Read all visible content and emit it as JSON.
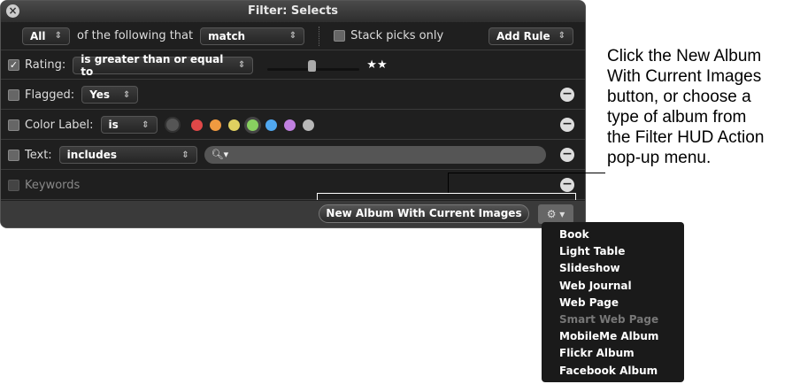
{
  "window": {
    "title": "Filter: Selects"
  },
  "match_row": {
    "scope": "All",
    "text": "of the following that",
    "mode": "match",
    "stack_picks_label": "Stack picks only",
    "stack_picks_checked": false,
    "add_rule": "Add Rule"
  },
  "rules": {
    "rating": {
      "label": "Rating:",
      "checked": true,
      "operator": "is greater than or equal to",
      "value_stars": "★★",
      "slider_value": 2
    },
    "flagged": {
      "label": "Flagged:",
      "checked": false,
      "value": "Yes"
    },
    "color_label": {
      "label": "Color Label:",
      "checked": false,
      "operator": "is",
      "selected": "green"
    },
    "text": {
      "label": "Text:",
      "checked": false,
      "operator": "includes",
      "search_value": ""
    },
    "keywords": {
      "label": "Keywords",
      "checked": false
    }
  },
  "colors": {
    "none": "#555555",
    "red": "#e04848",
    "orange": "#f09a40",
    "yellow": "#e0d060",
    "green": "#88d060",
    "blue": "#50a8f0",
    "purple": "#c080e0",
    "gray": "#b8b8b8"
  },
  "bottom": {
    "new_album": "New Album With Current Images"
  },
  "menu": {
    "items": [
      {
        "label": "Book"
      },
      {
        "label": "Light Table"
      },
      {
        "label": "Slideshow"
      },
      {
        "label": "Web Journal"
      },
      {
        "label": "Web Page"
      },
      {
        "label": "Smart Web Page",
        "disabled": true
      },
      {
        "label": "MobileMe Album"
      },
      {
        "label": "Flickr Album"
      },
      {
        "label": "Facebook Album"
      }
    ]
  },
  "callout": [
    "Click the New Album",
    "With Current Images",
    "button, or choose a",
    "type of album from",
    "the Filter HUD Action",
    "pop-up menu."
  ]
}
